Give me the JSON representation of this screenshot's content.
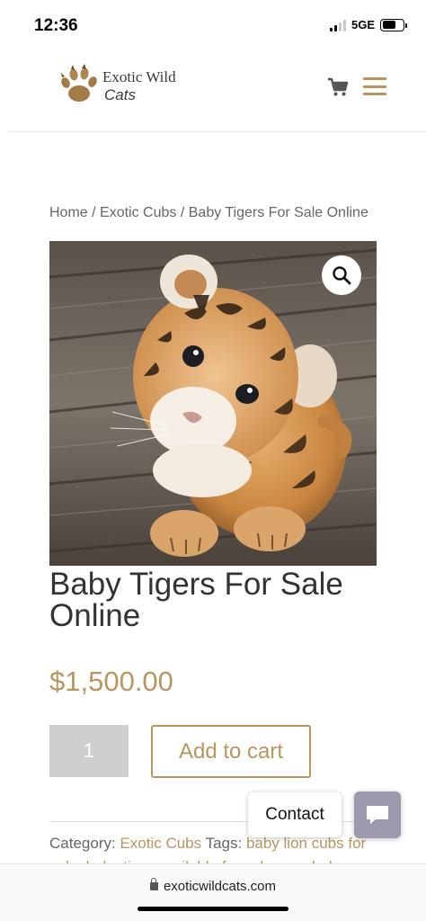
{
  "status_bar": {
    "time": "12:36",
    "network": "5GE"
  },
  "header": {
    "logo_line1": "Exotic Wild",
    "logo_line2": "Cats",
    "logo_icon": "paw-icon",
    "cart_icon": "cart-icon",
    "menu_icon": "hamburger-menu-icon"
  },
  "breadcrumb": {
    "items": [
      "Home",
      "Exotic Cubs",
      "Baby Tigers For Sale Online"
    ],
    "separator": " / "
  },
  "product": {
    "title": "Baby Tigers For Sale Online",
    "price": "$1,500.00",
    "quantity": "1",
    "add_to_cart_label": "Add to cart",
    "zoom_icon": "magnifier-icon"
  },
  "meta": {
    "category_label": "Category:",
    "category_value": "Exotic Cubs",
    "tags_label": "Tags:",
    "tags_value": "baby lion cubs for sale, baby tiger available for sale now, baby"
  },
  "contact_widget": {
    "label": "Contact",
    "chat_icon": "chat-bubble-icon"
  },
  "browser": {
    "url": "exoticwildcats.com"
  },
  "colors": {
    "accent": "#b8965e",
    "qty_bg": "#cfcfcf",
    "chat_button": "#9f99ad"
  }
}
